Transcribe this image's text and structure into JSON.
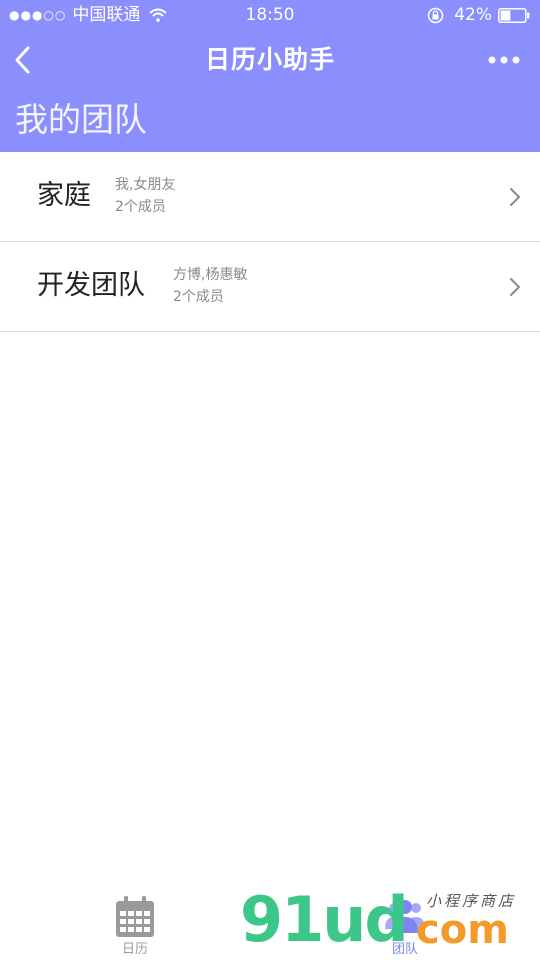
{
  "status_bar": {
    "signal_dots": "●●●○○",
    "carrier": "中国联通",
    "time": "18:50",
    "battery_percent": "42%",
    "battery_level": 0.42,
    "icons": [
      "wifi-icon",
      "orientation-lock-icon",
      "battery-icon"
    ]
  },
  "nav": {
    "title": "日历小助手",
    "back_icon": "chevron-left-icon",
    "more_icon": "more-dots-icon"
  },
  "page": {
    "title": "我的团队"
  },
  "teams": [
    {
      "name": "家庭",
      "members": "我,女朋友",
      "count": "2个成员"
    },
    {
      "name": "开发团队",
      "members": "方博,杨惠敏",
      "count": "2个成员"
    }
  ],
  "tabs": [
    {
      "label": "日历",
      "icon": "calendar-icon",
      "active": false
    },
    {
      "label": "团队",
      "icon": "team-icon",
      "active": true
    }
  ],
  "watermark": {
    "logo": "91ud",
    "domain": "com",
    "subtitle": "小程序商店"
  },
  "colors": {
    "header": "#8b8ffe",
    "active_tab": "#7f84f5",
    "inactive_tab": "#9a9a9a"
  }
}
